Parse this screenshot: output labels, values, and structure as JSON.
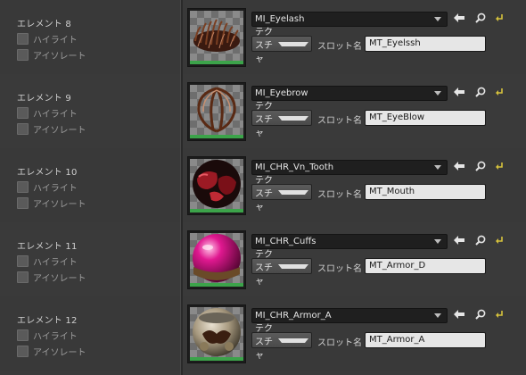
{
  "labels": {
    "highlight": "ハイライト",
    "isolate": "アイソレート",
    "texture_button": "テクスチャ",
    "slot_name": "スロット名"
  },
  "colors": {
    "accent_green": "#3ca34a",
    "icon_yellow": "#d6c23c"
  },
  "elements": [
    {
      "title": "エレメント 8",
      "material": "MI_Eyelash",
      "slot": "MT_Eyelssh",
      "preview": "eyelash"
    },
    {
      "title": "エレメント 9",
      "material": "MI_Eyebrow",
      "slot": "MT_EyeBlow",
      "preview": "eyebrow"
    },
    {
      "title": "エレメント 10",
      "material": "MI_CHR_Vn_Tooth",
      "slot": "MT_Mouth",
      "preview": "tooth"
    },
    {
      "title": "エレメント 11",
      "material": "MI_CHR_Cuffs",
      "slot": "MT_Armor_D",
      "preview": "cuffs"
    },
    {
      "title": "エレメント 12",
      "material": "MI_CHR_Armor_A",
      "slot": "MT_Armor_A",
      "preview": "armor"
    }
  ],
  "icons": [
    "arrow-left-icon",
    "search-icon",
    "reset-arrow-icon"
  ]
}
